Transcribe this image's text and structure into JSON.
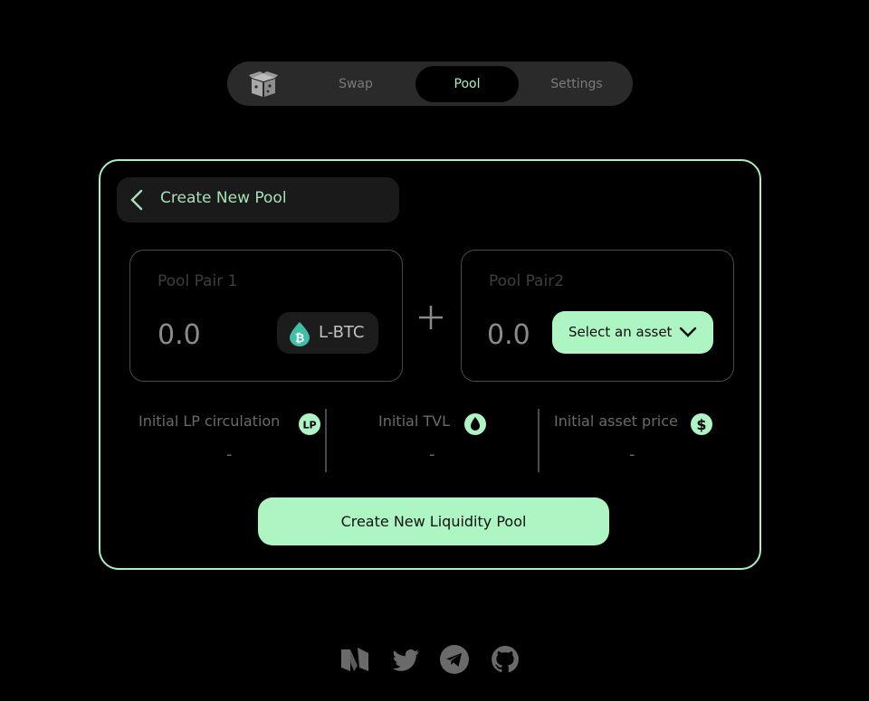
{
  "nav": {
    "logo_icon": "box-icon",
    "tabs": [
      {
        "label": "Swap",
        "active": false
      },
      {
        "label": "Pool",
        "active": true
      },
      {
        "label": "Settings",
        "active": false
      }
    ]
  },
  "card": {
    "back_icon": "chevron-left-icon",
    "title": "Create New Pool",
    "pair1": {
      "label": "Pool Pair 1",
      "amount": "0.0",
      "asset": {
        "icon": "bitcoin-drop-icon",
        "symbol": "L-BTC"
      }
    },
    "plus_icon": "plus-icon",
    "pair2": {
      "label": "Pool Pair2",
      "amount": "0.0",
      "select_label": "Select an asset",
      "select_icon": "chevron-down-icon"
    },
    "stats": [
      {
        "label": "Initial LP circulation",
        "icon": "lp-icon",
        "value": "-"
      },
      {
        "label": "Initial TVL",
        "icon": "drop-icon",
        "value": "-"
      },
      {
        "label": "Initial asset price",
        "icon": "dollar-icon",
        "value": "-"
      }
    ],
    "create_button": "Create New Liquidity Pool"
  },
  "footer": {
    "links": [
      "medium-icon",
      "twitter-icon",
      "telegram-icon",
      "github-icon"
    ]
  },
  "colors": {
    "accent": "#aef5c4",
    "border": "#a8f0c0",
    "background": "#000000",
    "nav_bg": "#2a2a2a",
    "lbtc_teal": "#3fbfa6"
  }
}
